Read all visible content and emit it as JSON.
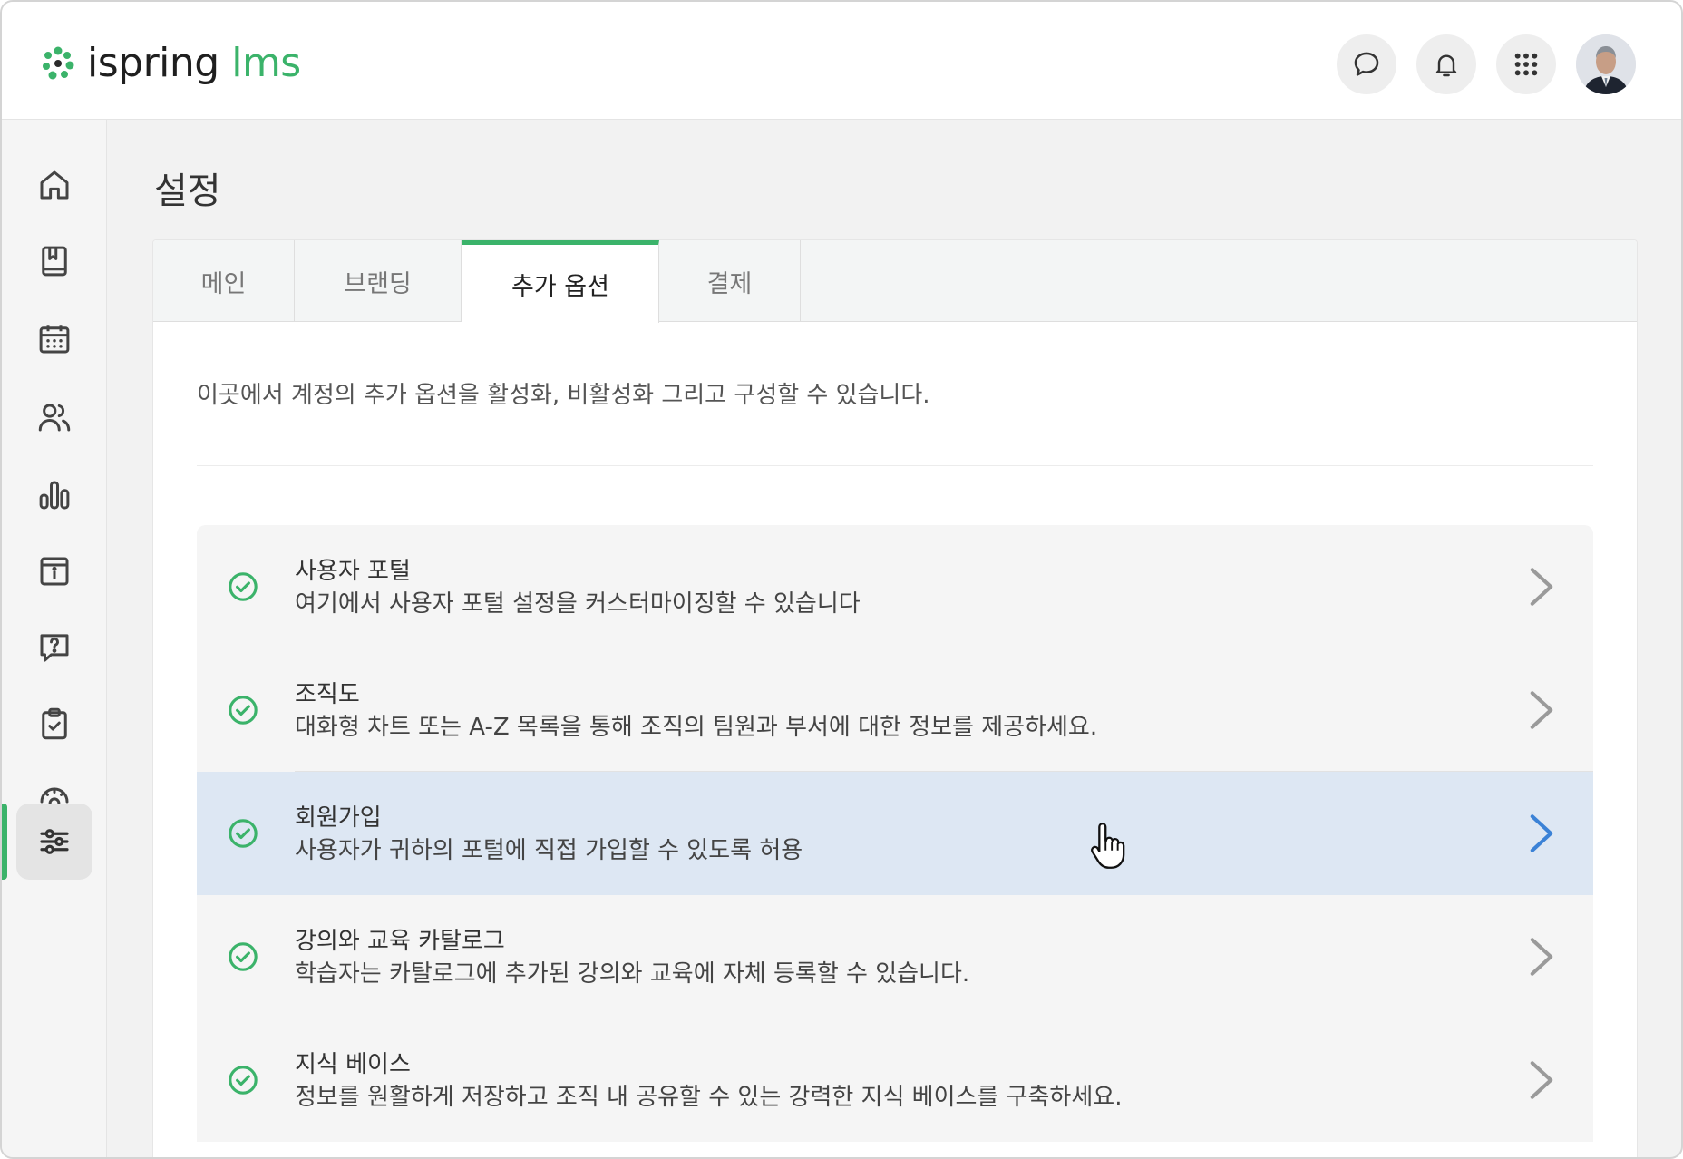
{
  "brand": {
    "word1": "ispring",
    "word2": "lms",
    "accent": "#3bb36a"
  },
  "header": {
    "icons": [
      "chat-icon",
      "bell-icon",
      "apps-grid-icon",
      "user-avatar"
    ]
  },
  "sidebar": {
    "items": [
      {
        "name": "home-icon",
        "active": false
      },
      {
        "name": "book-icon",
        "active": false
      },
      {
        "name": "calendar-icon",
        "active": false
      },
      {
        "name": "users-icon",
        "active": false
      },
      {
        "name": "reports-icon",
        "active": false
      },
      {
        "name": "info-icon",
        "active": false
      },
      {
        "name": "help-icon",
        "active": false
      },
      {
        "name": "tasks-icon",
        "active": false
      },
      {
        "name": "supervisor-icon",
        "active": false
      },
      {
        "name": "settings-sliders-icon",
        "active": true
      }
    ]
  },
  "page": {
    "title": "설정"
  },
  "tabs": [
    {
      "label": "메인",
      "active": false
    },
    {
      "label": "브랜딩",
      "active": false
    },
    {
      "label": "추가 옵션",
      "active": true
    },
    {
      "label": "결제",
      "active": false
    }
  ],
  "content": {
    "description": "이곳에서 계정의 추가 옵션을 활성화, 비활성화 그리고 구성할 수 있습니다.",
    "options": [
      {
        "title": "사용자 포털",
        "subtitle": "여기에서 사용자 포털 설정을 커스터마이징할 수 있습니다",
        "enabled": true,
        "hover": false
      },
      {
        "title": "조직도",
        "subtitle": "대화형 차트 또는 A-Z 목록을 통해 조직의 팀원과 부서에 대한 정보를 제공하세요.",
        "enabled": true,
        "hover": false
      },
      {
        "title": "회원가입",
        "subtitle": "사용자가 귀하의 포털에 직접 가입할 수 있도록 허용",
        "enabled": true,
        "hover": true
      },
      {
        "title": "강의와 교육 카탈로그",
        "subtitle": "학습자는 카탈로그에 추가된 강의와 교육에 자체 등록할 수 있습니다.",
        "enabled": true,
        "hover": false
      },
      {
        "title": "지식 베이스",
        "subtitle": "정보를 원활하게 저장하고 조직 내 공유할 수 있는 강력한 지식 베이스를 구축하세요.",
        "enabled": true,
        "hover": false
      }
    ]
  },
  "colors": {
    "check": "#3bb36a",
    "hover_row": "#dde7f3",
    "hover_chevron": "#3b82d6",
    "chevron": "#9a9a9a"
  }
}
